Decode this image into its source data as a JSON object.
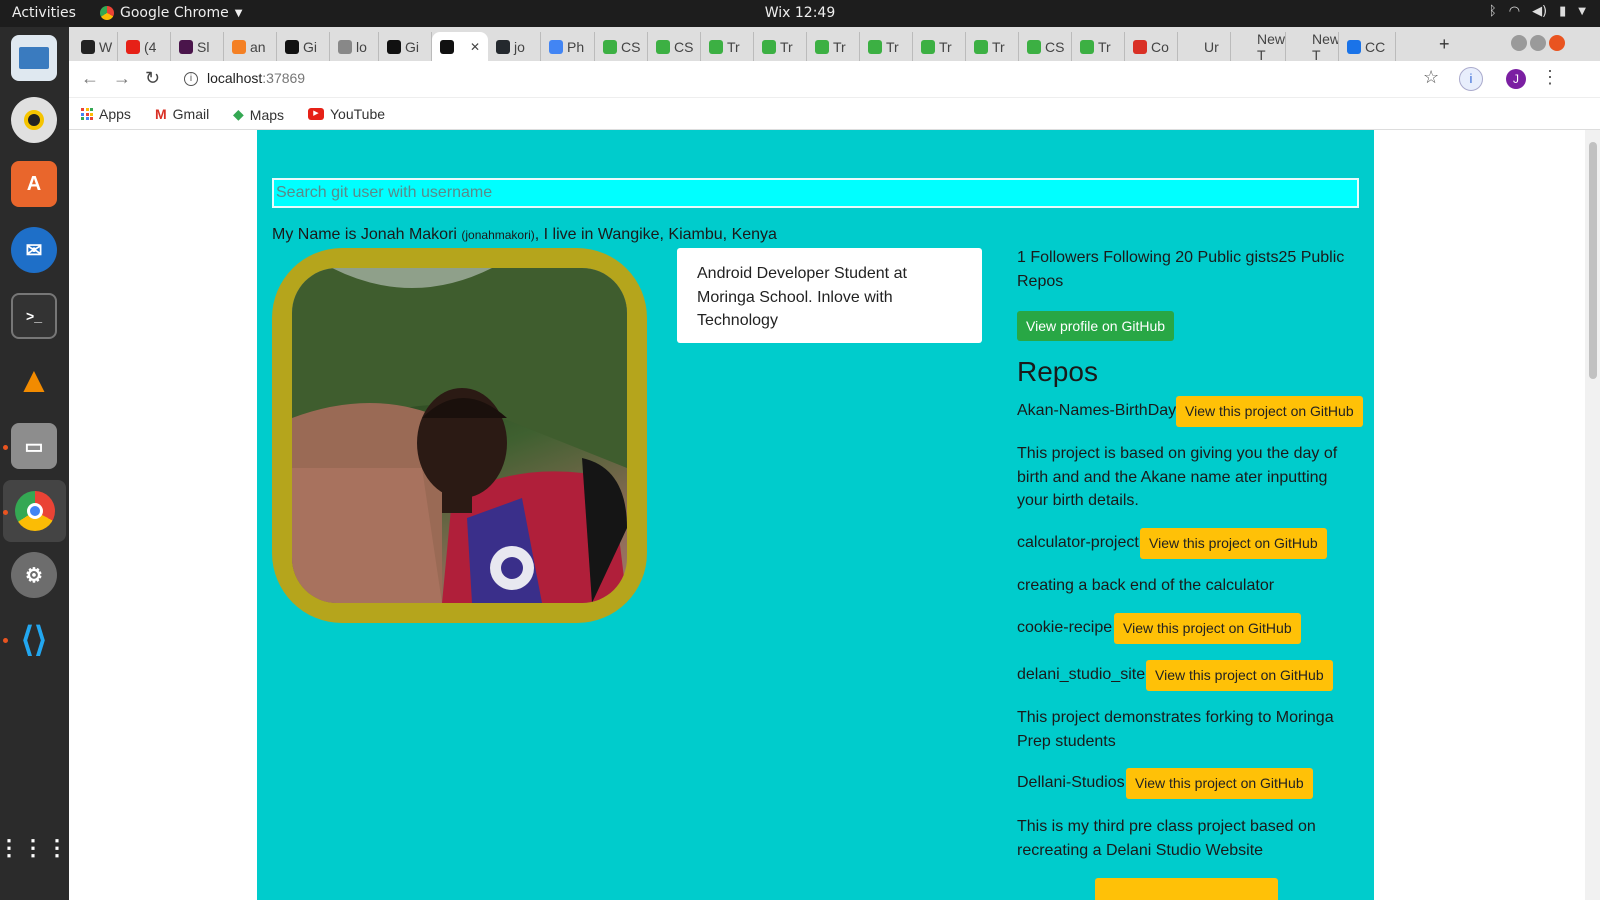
{
  "os": {
    "activities": "Activities",
    "app_menu": "Google Chrome",
    "clock": "Wix 12:49"
  },
  "tabs": [
    {
      "label": "W",
      "color": "#222222"
    },
    {
      "label": "(4",
      "color": "#e62117"
    },
    {
      "label": "Sl",
      "color": "#4a154b"
    },
    {
      "label": "an",
      "color": "#f48024"
    },
    {
      "label": "Gi",
      "color": "#111111"
    },
    {
      "label": "lo",
      "color": "#888888"
    },
    {
      "label": "Gi",
      "color": "#111111"
    },
    {
      "label": "",
      "color": "#111111"
    },
    {
      "label": "jo",
      "color": "#24292e"
    },
    {
      "label": "Ph",
      "color": "#4285f4"
    },
    {
      "label": "CS",
      "color": "#3cb043"
    },
    {
      "label": "CS",
      "color": "#3cb043"
    },
    {
      "label": "Tr",
      "color": "#3cb043"
    },
    {
      "label": "Tr",
      "color": "#3cb043"
    },
    {
      "label": "Tr",
      "color": "#3cb043"
    },
    {
      "label": "Tr",
      "color": "#3cb043"
    },
    {
      "label": "Tr",
      "color": "#3cb043"
    },
    {
      "label": "Tr",
      "color": "#3cb043"
    },
    {
      "label": "CS",
      "color": "#3cb043"
    },
    {
      "label": "Tr",
      "color": "#3cb043"
    },
    {
      "label": "Co",
      "color": "#d93025"
    },
    {
      "label": "Ur",
      "color": "#dedede"
    },
    {
      "label": "New T",
      "color": "#dedede"
    },
    {
      "label": "New T",
      "color": "#dedede"
    },
    {
      "label": "CC",
      "color": "#1a73e8"
    }
  ],
  "browser": {
    "url_host": "localhost",
    "url_port": ":37869",
    "profile_initial": "J",
    "bookmarks": [
      "Apps",
      "Gmail",
      "Maps",
      "YouTube"
    ]
  },
  "page": {
    "search_placeholder": "Search git user with username",
    "intro_prefix": "My Name is Jonah Makori ",
    "intro_username": "(jonahmakori)",
    "intro_suffix": ", I live in Wangike, Kiambu, Kenya",
    "bio": "Android Developer Student at Moringa School. Inlove with Technology",
    "stats": "1 Followers Following 20 Public gists25 Public Repos",
    "profile_button": "View profile on GitHub",
    "repos_title": "Repos",
    "repos": [
      {
        "name": "Akan-Names-BirthDay",
        "button": "View this project on GitHub",
        "description": "This project is based on giving you the day of birth and and the Akane name ater inputting your birth details."
      },
      {
        "name": "calculator-project",
        "button": "View this project on GitHub",
        "description": "creating a back end of the calculator"
      },
      {
        "name": "cookie-recipe",
        "button": "View this project on GitHub",
        "description": ""
      },
      {
        "name": "delani_studio_site",
        "button": "View this project on GitHub",
        "description": "This project demonstrates forking to Moringa Prep students"
      },
      {
        "name": "Dellani-Studios",
        "button": "View this project on GitHub",
        "description": "This is my third pre class project based on recreating a Delani Studio Website"
      }
    ]
  }
}
